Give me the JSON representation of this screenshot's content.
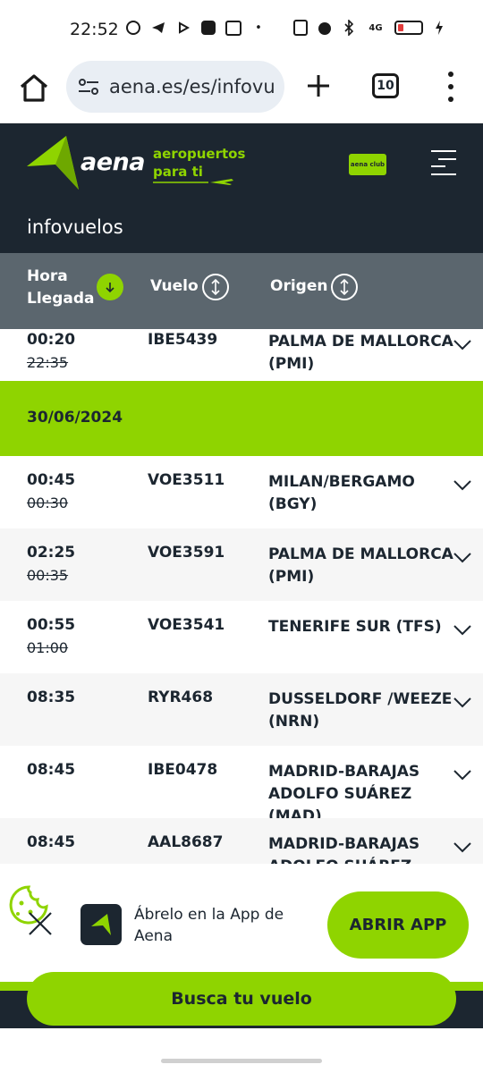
{
  "status_bar": {
    "time": "22:52",
    "network": "4G"
  },
  "browser": {
    "url": "aena.es/es/infovu",
    "tab_count": "10"
  },
  "header": {
    "brand": "aena",
    "tagline_line1": "aeropuertos",
    "tagline_line2": "para ti",
    "club_badge": "aena club",
    "section_title": "infovuelos"
  },
  "columns": {
    "time_line1": "Hora",
    "time_line2": "Llegada",
    "flight": "Vuelo",
    "origin": "Origen"
  },
  "rows_before": [
    {
      "time": "00:20",
      "scheduled": "22:35",
      "flight": "IBE5439",
      "origin": "PALMA DE MALLORCA (PMI)"
    }
  ],
  "date_group": "30/06/2024",
  "rows": [
    {
      "time": "00:45",
      "scheduled": "00:30",
      "flight": "VOE3511",
      "origin": "MILAN/BERGAMO (BGY)"
    },
    {
      "time": "02:25",
      "scheduled": "00:35",
      "flight": "VOE3591",
      "origin": "PALMA DE MALLORCA (PMI)"
    },
    {
      "time": "00:55",
      "scheduled": "01:00",
      "flight": "VOE3541",
      "origin": "TENERIFE SUR (TFS)"
    },
    {
      "time": "08:35",
      "scheduled": "",
      "flight": "RYR468",
      "origin": "DUSSELDORF /WEEZE (NRN)"
    },
    {
      "time": "08:45",
      "scheduled": "",
      "flight": "IBE0478",
      "origin": "MADRID-BARAJAS ADOLFO SUÁREZ (MAD)"
    },
    {
      "time": "08:45",
      "scheduled": "",
      "flight": "AAL8687",
      "origin": "MADRID-BARAJAS ADOLFO SUÁREZ (MAD)"
    }
  ],
  "app_banner": {
    "text": "Ábrelo en la App de Aena",
    "button": "ABRIR APP"
  },
  "search_button": "Busca tu vuelo",
  "colors": {
    "accent": "#8fd400",
    "dark": "#1c2630",
    "header_grey": "#5b666e"
  }
}
